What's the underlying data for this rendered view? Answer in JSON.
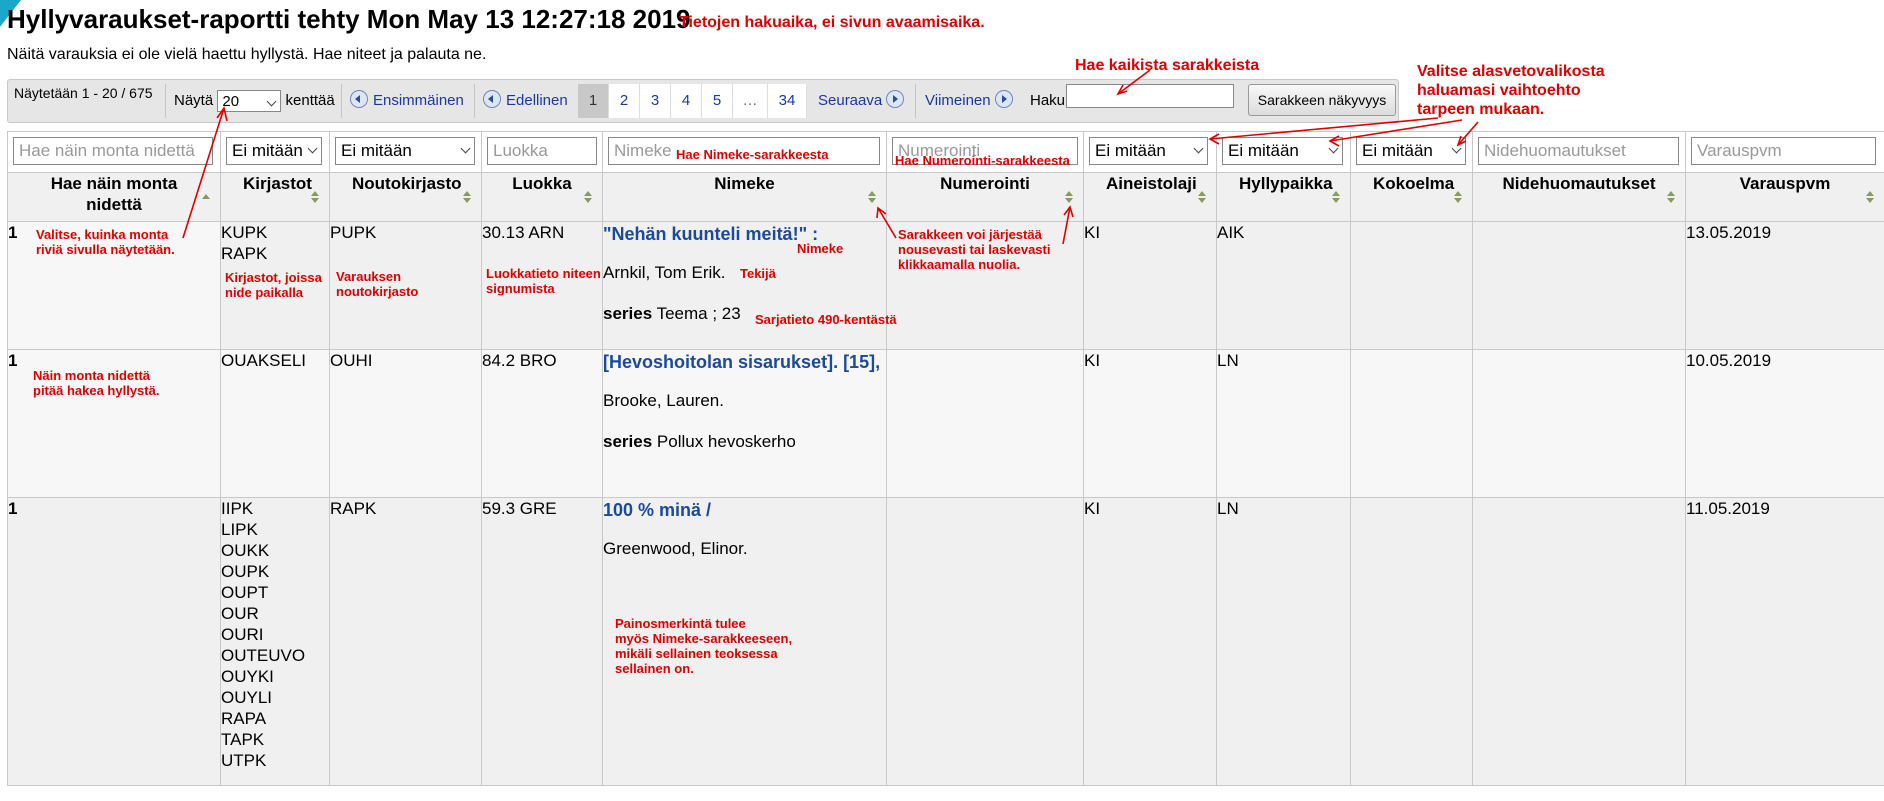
{
  "page": {
    "title": "Hyllyvaraukset-raportti tehty Mon May 13 12:27:18 2019",
    "title_note": "Tietojen hakuaika, ei sivun avaamisaika.",
    "subtitle": "Näitä varauksia ei ole vielä haettu hyllystä. Hae niteet ja palauta ne."
  },
  "toolbar": {
    "showing": "Näytetään 1 - 20 / 675",
    "show_label": "Näytä",
    "show_value": "20",
    "show_suffix": "kenttää",
    "first": "Ensimmäinen",
    "prev": "Edellinen",
    "pages": [
      "1",
      "2",
      "3",
      "4",
      "5",
      "…",
      "34"
    ],
    "current_page": "1",
    "next": "Seuraava",
    "last": "Viimeinen",
    "search_label": "Haku:",
    "search_value": "",
    "column_visibility": "Sarakkeen näkyvyys"
  },
  "filters": {
    "count": "Hae näin monta nidettä",
    "libraries": "Ei mitään",
    "pickup": "Ei mitään",
    "class": "Luokka",
    "title": "Nimeke",
    "numbering": "Numerointi",
    "itemtype": "Ei mitään",
    "location": "Ei mitään",
    "collection": "Ei mitään",
    "notes": "Nidehuomautukset",
    "date": "Varauspvm"
  },
  "columns": [
    "Hae näin monta nidettä",
    "Kirjastot",
    "Noutokirjasto",
    "Luokka",
    "Nimeke",
    "Numerointi",
    "Aineistolaji",
    "Hyllypaikka",
    "Kokoelma",
    "Nidehuomautukset",
    "Varauspvm"
  ],
  "rows": [
    {
      "count": "1",
      "libraries": [
        "KUPK",
        "RAPK"
      ],
      "pickup": "PUPK",
      "class": "30.13 ARN",
      "title": "\"Nehän kuunteli meitä!\" :",
      "author": "Arnkil, Tom Erik.",
      "series_label": "series",
      "series": "Teema ; 23",
      "itemtype": "KI",
      "location": "AIK",
      "date": "13.05.2019"
    },
    {
      "count": "1",
      "libraries": [
        "OUAKSELI"
      ],
      "pickup": "OUHI",
      "class": "84.2 BRO",
      "title": "[Hevoshoitolan sisarukset]. [15],",
      "author": "Brooke, Lauren.",
      "series_label": "series",
      "series": "Pollux hevoskerho",
      "itemtype": "KI",
      "location": "LN",
      "date": "10.05.2019"
    },
    {
      "count": "1",
      "libraries": [
        "IIPK",
        "LIPK",
        "OUKK",
        "OUPK",
        "OUPT",
        "OUR",
        "OURI",
        "OUTEUVO",
        "OUYKI",
        "OUYLI",
        "RAPA",
        "TAPK",
        "UTPK"
      ],
      "pickup": "RAPK",
      "class": "59.3 GRE",
      "title": "100 % minä /",
      "author": "Greenwood, Elinor.",
      "itemtype": "KI",
      "location": "LN",
      "date": "11.05.2019"
    }
  ],
  "annotations": {
    "search_all": "Hae kaikista sarakkeista",
    "dropdown": [
      "Valitse alasvetovalikosta",
      "haluamasi vaihtoehto",
      "tarpeen mukaan."
    ],
    "title_search": "Hae Nimeke-sarakkeesta",
    "numbering_search": "Hae Numerointi-sarakkeesta",
    "rows_per_page": [
      "Valitse, kuinka monta",
      "riviä sivulla näytetään."
    ],
    "libraries": [
      "Kirjastot, joissa",
      "nide paikalla"
    ],
    "pickup": [
      "Varauksen",
      "noutokirjasto"
    ],
    "class": [
      "Luokkatieto niteen",
      "signumista"
    ],
    "title": "Nimeke",
    "author": "Tekijä",
    "series": "Sarjatieto 490-kentästä",
    "sort": [
      "Sarakkeen voi järjestää",
      "nousevasti tai laskevasti",
      "klikkaamalla nuolia."
    ],
    "count": [
      "Näin monta nidettä",
      "pitää hakea hyllystä."
    ],
    "edition": [
      "Painosmerkintä tulee",
      "myös Nimeke-sarakkeeseen,",
      "mikäli sellainen teoksessa",
      "sellainen on."
    ]
  },
  "colors": {
    "annotation": "#e00000",
    "link": "#1a4aa0",
    "stripe": "#1aa7c9"
  }
}
